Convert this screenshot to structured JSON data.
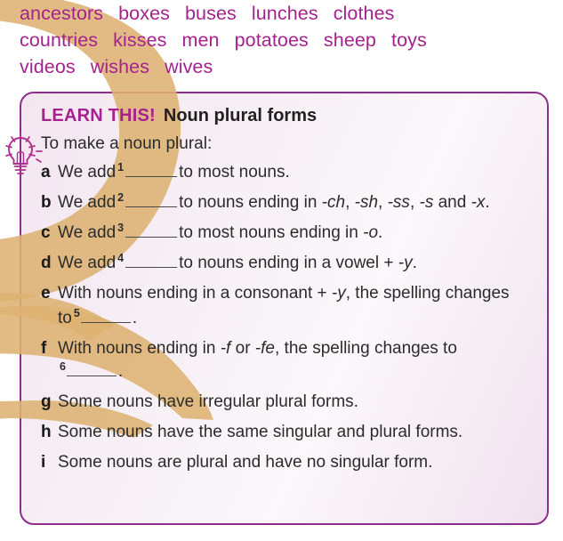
{
  "word_list": {
    "rows": [
      [
        "ancestors",
        "boxes",
        "buses",
        "lunches",
        "clothes"
      ],
      [
        "countries",
        "kisses",
        "men",
        "potatoes",
        "sheep",
        "toys"
      ],
      [
        "videos",
        "wishes",
        "wives"
      ]
    ]
  },
  "learn_box": {
    "label": "LEARN THIS!",
    "title": "Noun plural forms",
    "intro": "To make a noun plural:",
    "rules": [
      {
        "letter": "a",
        "before": "We add",
        "marker": "1",
        "after": "to most nouns."
      },
      {
        "letter": "b",
        "before": "We add",
        "marker": "2",
        "after": "to nouns ending in ",
        "italic_1": "-ch",
        "mid_1": ", ",
        "italic_2": "-sh",
        "mid_2": ", ",
        "italic_3": "-ss",
        "mid_3": ", ",
        "italic_4": "-s",
        "mid_4": " and ",
        "italic_5": "-x",
        "end": "."
      },
      {
        "letter": "c",
        "before": "We add",
        "marker": "3",
        "after": "to most nouns ending in ",
        "italic_1": "-o",
        "end": "."
      },
      {
        "letter": "d",
        "before": "We add",
        "marker": "4",
        "after": "to nouns ending in a vowel + ",
        "italic_1": "-y",
        "end": "."
      },
      {
        "letter": "e",
        "before": "With nouns ending in a consonant + ",
        "italic_1": "-y",
        "mid_1": ", the spelling changes to",
        "marker": "5",
        "end": "."
      },
      {
        "letter": "f",
        "before": "With nouns ending in ",
        "italic_1": "-f",
        "mid_1": " or ",
        "italic_2": "-fe",
        "mid_2": ", the spelling changes to",
        "marker": "6",
        "end": "."
      },
      {
        "letter": "g",
        "text": "Some nouns have irregular plural forms."
      },
      {
        "letter": "h",
        "text": "Some nouns have the same singular and plural forms."
      },
      {
        "letter": "i",
        "text": "Some nouns are plural and have no singular form."
      }
    ]
  },
  "icons": {
    "bulb": "lightbulb-icon",
    "swoosh": "gold-swoosh-decoration"
  },
  "colors": {
    "accent_magenta": "#A5228E",
    "box_border": "#8E2D8E",
    "swoosh_gold": "#DDB272",
    "body_text": "#2B2B2B",
    "box_background": "#F5ECF3"
  }
}
